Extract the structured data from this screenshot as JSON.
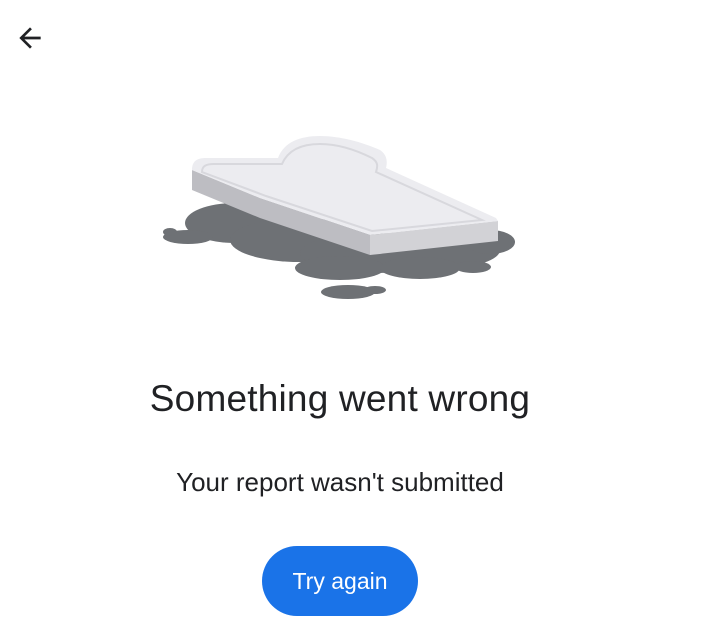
{
  "navigation": {
    "back_icon": "arrow-back-icon"
  },
  "illustration": {
    "icon": "spilled-toast-icon",
    "colors": {
      "toast_top": "#ececf0",
      "toast_side": "#c4c4c8",
      "puddle": "#6e7175"
    }
  },
  "error": {
    "title": "Something went wrong",
    "message": "Your report wasn't submitted"
  },
  "actions": {
    "retry_label": "Try again"
  },
  "colors": {
    "accent": "#1a73e8",
    "text": "#202124",
    "background": "#ffffff"
  }
}
